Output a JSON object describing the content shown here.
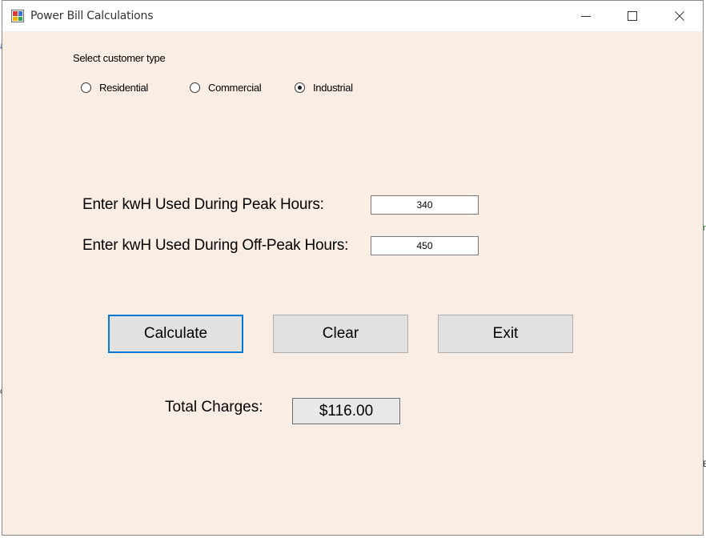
{
  "window": {
    "title": "Power Bill Calculations",
    "client_bg": "#faeee4"
  },
  "icons": {
    "app": "application-icon",
    "minimize": "minimize-icon",
    "maximize": "maximize-icon",
    "close": "close-icon"
  },
  "customer_type": {
    "label": "Select customer type",
    "options": [
      {
        "label": "Residential",
        "selected": false
      },
      {
        "label": "Commercial",
        "selected": false
      },
      {
        "label": "Industrial",
        "selected": true
      }
    ]
  },
  "inputs": {
    "peak": {
      "label": "Enter kwH Used During Peak Hours:",
      "value": "340"
    },
    "offpeak": {
      "label": "Enter kwH Used During Off-Peak Hours:",
      "value": "450"
    }
  },
  "buttons": {
    "calculate": "Calculate",
    "clear": "Clear",
    "exit": "Exit"
  },
  "result": {
    "label": "Total Charges:",
    "value": "$116.00"
  },
  "accent_color": "#0078d7"
}
